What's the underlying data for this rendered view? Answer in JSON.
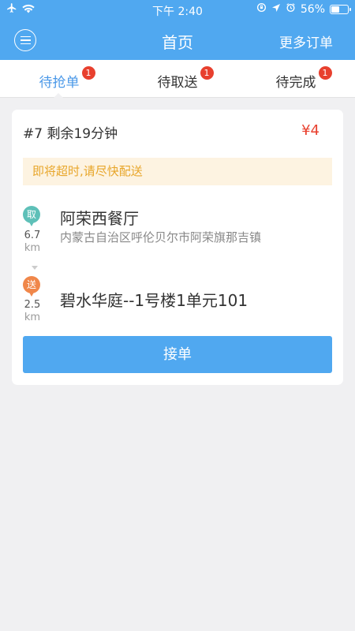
{
  "status_bar": {
    "time": "下午 2:40",
    "battery_text": "56%",
    "battery_level": 0.56
  },
  "nav": {
    "title": "首页",
    "right_link": "更多订单"
  },
  "tabs": [
    {
      "label": "待抢单",
      "badge": "1",
      "active": true
    },
    {
      "label": "待取送",
      "badge": "1",
      "active": false
    },
    {
      "label": "待完成",
      "badge": "1",
      "active": false
    }
  ],
  "order": {
    "title": "#7 剩余19分钟",
    "price": "¥4",
    "warning": "即将超时,请尽快配送",
    "pickup": {
      "pin_label": "取",
      "distance": "6.7",
      "unit": "km",
      "name": "阿荣西餐厅",
      "address": "内蒙古自治区呼伦贝尔市阿荣旗那吉镇"
    },
    "delivery": {
      "pin_label": "送",
      "distance": "2.5",
      "unit": "km",
      "name": "碧水华庭--1号楼1单元101"
    },
    "accept_button": "接单"
  },
  "colors": {
    "primary": "#50a8f0",
    "badge": "#e8402e",
    "warning_text": "#e8a62a",
    "pickup_pin": "#5ec0b8",
    "delivery_pin": "#f0874a"
  },
  "icons": [
    "airplane-icon",
    "wifi-icon",
    "rotation-lock-icon",
    "location-arrow-icon",
    "alarm-icon",
    "battery-icon",
    "menu-icon"
  ]
}
